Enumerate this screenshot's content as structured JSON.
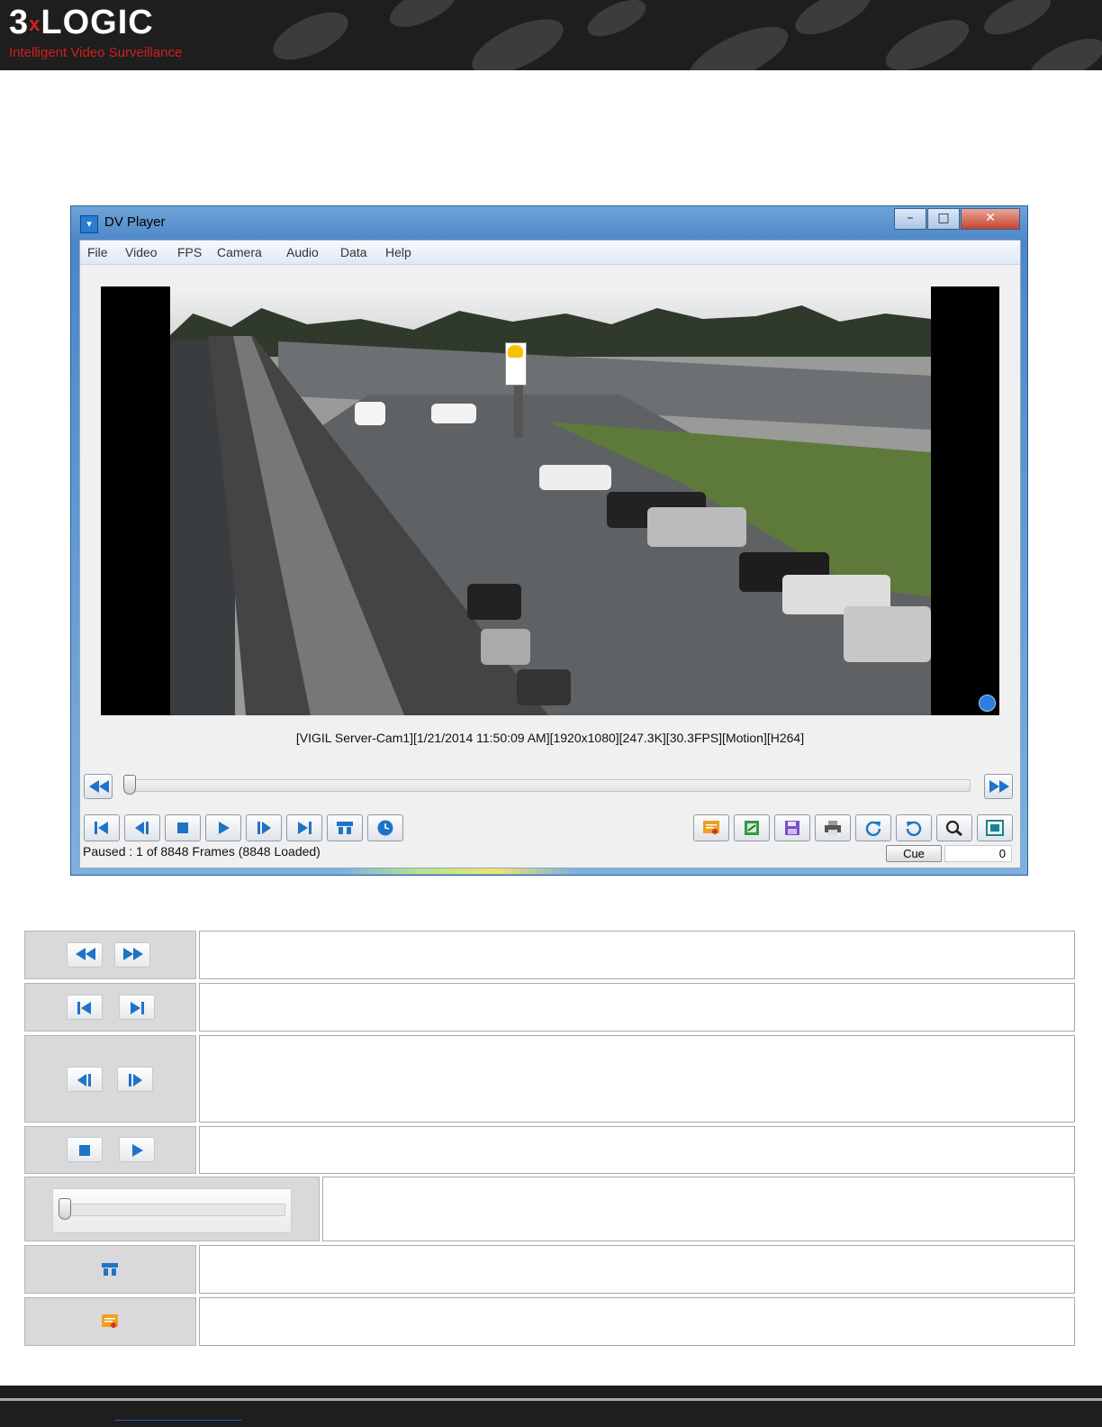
{
  "brand": {
    "logo_text": "3xLOGIC",
    "tagline": "Intelligent Video Surveillance"
  },
  "window": {
    "title": "DV Player",
    "buttons": {
      "minimize": "–",
      "maximize": "□",
      "close": "✕"
    }
  },
  "menu": [
    "File",
    "Video",
    "FPS",
    "Camera",
    "Audio",
    "Data",
    "Help"
  ],
  "video": {
    "info_line": "[VIGIL Server-Cam1][1/21/2014 11:50:09 AM][1920x1080][247.3K][30.3FPS][Motion][H264]",
    "badge_icon": "clock-icon"
  },
  "seek": {
    "left_icon": "rewind-icon",
    "right_icon": "fast-forward-icon",
    "position_fraction": 0.0
  },
  "toolbar_left": [
    "first-frame-icon",
    "step-back-icon",
    "stop-icon",
    "play-icon",
    "step-forward-icon",
    "last-frame-icon",
    "cue-marker-icon",
    "clock-icon"
  ],
  "toolbar_right": [
    "export-certificate-icon",
    "export-image-icon",
    "save-icon",
    "print-icon",
    "rotate-clockwise-icon",
    "rotate-counterclockwise-icon",
    "zoom-icon",
    "fit-screen-icon"
  ],
  "status": {
    "text": "Paused : 1 of 8848 Frames (8848 Loaded)",
    "cue_label": "Cue",
    "cue_value": "0"
  },
  "legend": [
    {
      "icons": [
        "rewind-icon",
        "fast-forward-icon"
      ],
      "description": ""
    },
    {
      "icons": [
        "first-frame-icon",
        "last-frame-icon"
      ],
      "description": ""
    },
    {
      "icons": [
        "step-back-icon",
        "step-forward-icon"
      ],
      "description": ""
    },
    {
      "icons": [
        "stop-icon",
        "play-icon"
      ],
      "description": ""
    },
    {
      "icons": [
        "seek-slider"
      ],
      "description": ""
    },
    {
      "icons": [
        "cue-marker-icon"
      ],
      "description": ""
    },
    {
      "icons": [
        "export-certificate-icon"
      ],
      "description": ""
    }
  ],
  "colors": {
    "accent_blue": "#2b7fe0",
    "brand_red": "#d41f1f",
    "banner_dark": "#1e1e1e"
  }
}
